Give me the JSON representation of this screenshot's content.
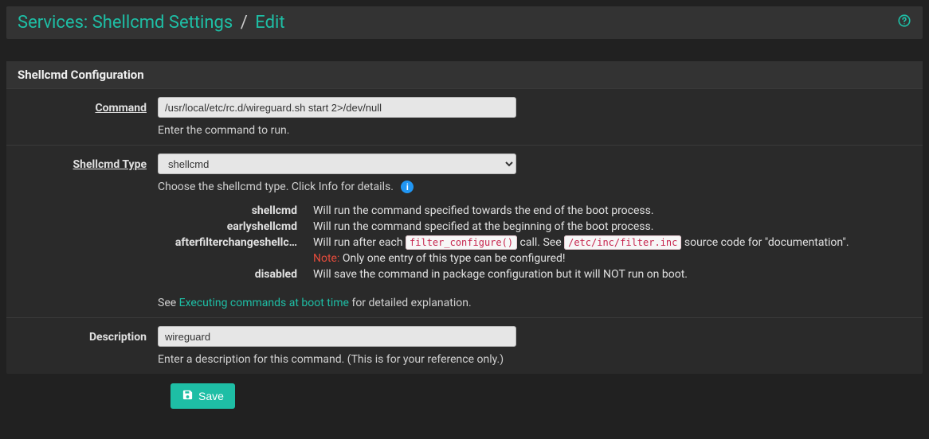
{
  "breadcrumb": {
    "root": "Services: Shellcmd Settings",
    "sep": "/",
    "leaf": "Edit"
  },
  "panel_title": "Shellcmd Configuration",
  "labels": {
    "command": "Command",
    "type": "Shellcmd Type",
    "description": "Description"
  },
  "command": {
    "value": "/usr/local/etc/rc.d/wireguard.sh start 2>/dev/null",
    "help": "Enter the command to run."
  },
  "type": {
    "selected": "shellcmd",
    "help": "Choose the shellcmd type. Click Info for details.",
    "rows": {
      "shellcmd": "Will run the command specified towards the end of the boot process.",
      "earlyshellcmd": "Will run the command specified at the beginning of the boot process.",
      "afterfilter_key": "afterfilterchangeshellc…",
      "afterfilter_pre": "Will run after each ",
      "afterfilter_code1": "filter_configure()",
      "afterfilter_mid": " call. See ",
      "afterfilter_code2": "/etc/inc/filter.inc",
      "afterfilter_post": " source code for \"documentation\".",
      "note_label": "Note:",
      "note_text": " Only one entry of this type can be configured!",
      "disabled": "Will save the command in package configuration but it will NOT run on boot."
    },
    "see_pre": "See ",
    "see_link": "Executing commands at boot time",
    "see_post": " for detailed explanation."
  },
  "description": {
    "value": "wireguard",
    "help": "Enter a description for this command. (This is for your reference only.)"
  },
  "save_label": "Save",
  "type_keys": {
    "k1": "shellcmd",
    "k2": "earlyshellcmd",
    "k4": "disabled"
  }
}
